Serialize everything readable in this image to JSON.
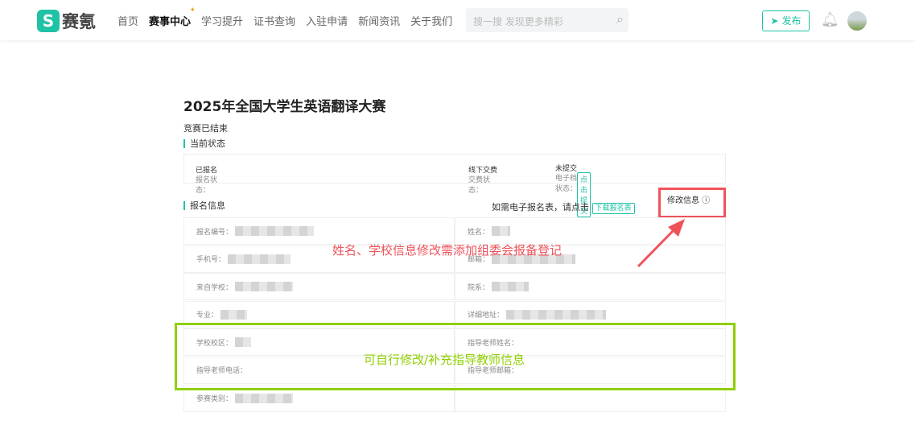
{
  "header": {
    "logo_mark": "S",
    "logo_text": "赛氪",
    "nav": [
      "首页",
      "赛事中心",
      "学习提升",
      "证书查询",
      "入驻申请",
      "新闻资讯",
      "关于我们"
    ],
    "search_placeholder": "搜一搜 发现更多精彩",
    "publish": "发布"
  },
  "page": {
    "title": "2025年全国大学生英语翻译大赛",
    "ended": "竞赛已结束",
    "status_section": "当前状态",
    "info_section": "报名信息"
  },
  "status": {
    "reg_label": "报名状态：",
    "reg_value": "已报名",
    "pay_label": "交费状态：",
    "pay_value": "线下交费",
    "doc_label": "电子档状态：",
    "doc_value": "未提交",
    "submit_btn": "点击提交"
  },
  "info": {
    "download_hint": "如需电子报名表，请点击",
    "download_btn": "下载报名表",
    "modify": "修改信息",
    "fields": [
      [
        "报名编号：",
        "姓名："
      ],
      [
        "手机号：",
        "邮箱："
      ],
      [
        "来自学校：",
        "院系："
      ],
      [
        "专业：",
        "详细地址："
      ],
      [
        "学校校区：",
        "指导老师姓名："
      ],
      [
        "指导老师电话：",
        "指导老师邮箱："
      ],
      [
        "参赛类别：",
        ""
      ]
    ]
  },
  "annotations": {
    "red": "姓名、学校信息修改需添加组委会报备登记",
    "green": "可自行修改/补充指导教师信息",
    "red_color": "#f0525a",
    "green_color": "#8fcf00"
  },
  "accent": "#1fc2a5"
}
